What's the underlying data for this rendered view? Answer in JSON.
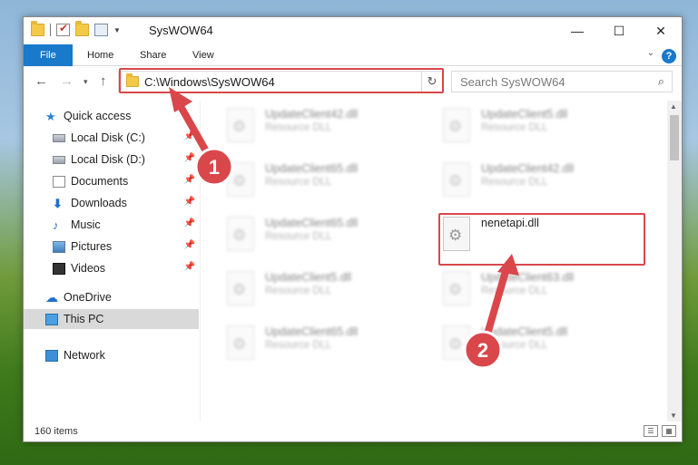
{
  "window": {
    "title": "SysWOW64"
  },
  "window_controls": {
    "minimize": "—",
    "maximize": "☐",
    "close": "✕"
  },
  "ribbon": {
    "tabs": [
      {
        "label": "File"
      },
      {
        "label": "Home"
      },
      {
        "label": "Share"
      },
      {
        "label": "View"
      }
    ],
    "help": "?"
  },
  "navigation": {
    "address": "C:\\Windows\\SysWOW64",
    "search_placeholder": "Search SysWOW64"
  },
  "sidebar": {
    "items": [
      {
        "label": "Quick access",
        "icon": "star-icon"
      },
      {
        "label": "Local Disk (C:)",
        "icon": "disk-icon",
        "pinned": true
      },
      {
        "label": "Local Disk (D:)",
        "icon": "disk-icon",
        "pinned": true
      },
      {
        "label": "Documents",
        "icon": "documents-icon",
        "pinned": true
      },
      {
        "label": "Downloads",
        "icon": "downloads-icon",
        "pinned": true
      },
      {
        "label": "Music",
        "icon": "music-icon",
        "pinned": true
      },
      {
        "label": "Pictures",
        "icon": "pictures-icon",
        "pinned": true
      },
      {
        "label": "Videos",
        "icon": "videos-icon",
        "pinned": true
      },
      {
        "label": "OneDrive",
        "icon": "onedrive-icon"
      },
      {
        "label": "This PC",
        "icon": "this-pc-icon",
        "selected": true
      },
      {
        "label": "Network",
        "icon": "network-icon"
      }
    ]
  },
  "files": [
    {
      "name": "UpdateClient42.dll",
      "type": "Resource DLL",
      "blurred": true
    },
    {
      "name": "UpdateClient5.dll",
      "type": "Resource DLL",
      "blurred": true
    },
    {
      "name": "UpdateClient65.dll",
      "type": "Resource DLL",
      "blurred": true
    },
    {
      "name": "UpdateClient42.dll",
      "type": "Resource DLL",
      "blurred": true
    },
    {
      "name": "UpdateClient65.dll",
      "type": "Resource DLL",
      "blurred": true
    },
    {
      "name": "nenetapi.dll",
      "type": "",
      "blurred": false,
      "highlighted": true
    },
    {
      "name": "UpdateClient5.dll",
      "type": "Resource DLL",
      "blurred": true
    },
    {
      "name": "UpdateClient63.dll",
      "type": "Resource DLL",
      "blurred": true
    },
    {
      "name": "UpdateClient65.dll",
      "type": "Resource DLL",
      "blurred": true
    },
    {
      "name": "UpdateClient5.dll",
      "type": "Resource DLL",
      "blurred": true
    }
  ],
  "status": {
    "item_count": "160 items"
  },
  "annotations": {
    "step1": "1",
    "step2": "2",
    "highlight_color": "#d9474b"
  }
}
